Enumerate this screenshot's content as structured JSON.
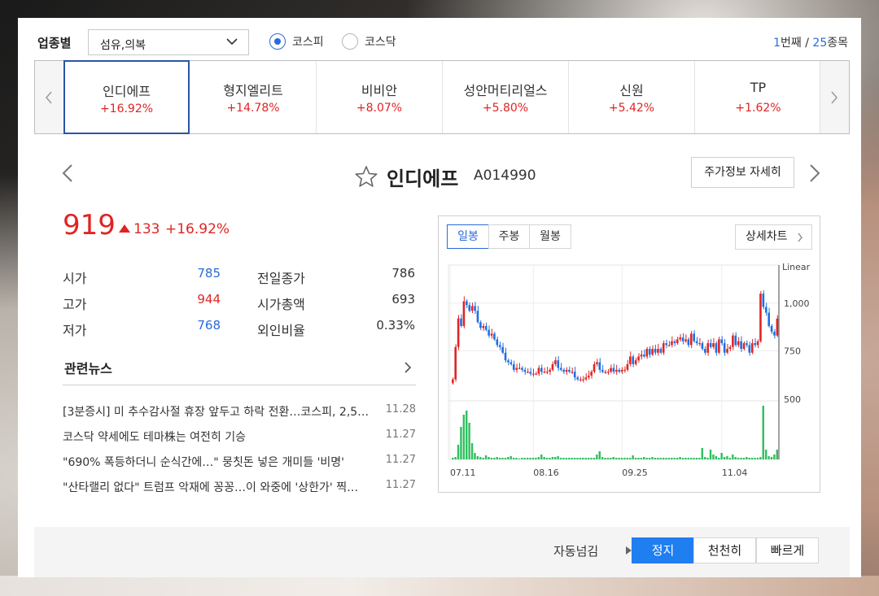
{
  "filter": {
    "sector_label": "업종별",
    "sector_value": "섬유,의복",
    "market_options": [
      {
        "label": "코스피",
        "selected": true
      },
      {
        "label": "코스닥",
        "selected": false
      }
    ],
    "pager": {
      "current": "1",
      "current_suffix": "번째",
      "separator": " / ",
      "total": "25",
      "total_suffix": "종목"
    }
  },
  "tabs": [
    {
      "name": "인디에프",
      "change": "+16.92%",
      "active": true
    },
    {
      "name": "형지엘리트",
      "change": "+14.78%",
      "active": false
    },
    {
      "name": "비비안",
      "change": "+8.07%",
      "active": false
    },
    {
      "name": "성안머티리얼스",
      "change": "+5.80%",
      "active": false
    },
    {
      "name": "신원",
      "change": "+5.42%",
      "active": false
    },
    {
      "name": "TP",
      "change": "+1.62%",
      "active": false
    }
  ],
  "stock": {
    "name": "인디에프",
    "code": "A014990",
    "detail_button": "주가정보 자세히",
    "price": "919",
    "change": "133",
    "change_pct": "+16.92%",
    "stats_left": [
      {
        "label": "시가",
        "value": "785",
        "color": "#2a6ad8"
      },
      {
        "label": "고가",
        "value": "944",
        "color": "#e02424"
      },
      {
        "label": "저가",
        "value": "768",
        "color": "#2a6ad8"
      }
    ],
    "stats_right": [
      {
        "label": "전일종가",
        "value": "786"
      },
      {
        "label": "시가총액",
        "value": "693"
      },
      {
        "label": "외인비율",
        "value": "0.33%"
      }
    ]
  },
  "news": {
    "title": "관련뉴스",
    "items": [
      {
        "title": "[3분증시] 미 추수감사절 휴장 앞두고 하락 전환…코스피, 2,5…",
        "date": "11.28"
      },
      {
        "title": "코스닥 약세에도 테마株는 여전히 기승",
        "date": "11.27"
      },
      {
        "title": "\"690% 폭등하더니 순식간에…\" 뭉칫돈 넣은 개미들 '비명'",
        "date": "11.27"
      },
      {
        "title": "\"산타랠리 없다\" 트럼프 악재에 꽁꽁…이 와중에 '상한가' 찍…",
        "date": "11.27"
      }
    ]
  },
  "chart": {
    "periods": [
      {
        "label": "일봉",
        "active": true
      },
      {
        "label": "주봉",
        "active": false
      },
      {
        "label": "월봉",
        "active": false
      }
    ],
    "detail_label": "상세차트",
    "scale_label": "Linear",
    "colors": {
      "up": "#e02424",
      "down": "#1f6fe0",
      "volume": "#2fbf5e"
    }
  },
  "chart_data": {
    "type": "candlestick",
    "ylim": [
      500,
      1200
    ],
    "yticks": [
      "1,000",
      "750",
      "500"
    ],
    "xticks": [
      "07.11",
      "08.16",
      "09.25",
      "11.04"
    ],
    "closes": [
      600,
      770,
      920,
      880,
      1010,
      990,
      960,
      985,
      960,
      900,
      870,
      880,
      860,
      830,
      840,
      810,
      780,
      770,
      740,
      700,
      690,
      680,
      650,
      660,
      660,
      650,
      640,
      640,
      630,
      630,
      630,
      660,
      640,
      640,
      640,
      650,
      680,
      700,
      660,
      650,
      640,
      650,
      640,
      640,
      610,
      600,
      600,
      600,
      610,
      620,
      640,
      680,
      690,
      650,
      640,
      640,
      640,
      660,
      640,
      650,
      640,
      650,
      650,
      680,
      720,
      680,
      700,
      720,
      730,
      720,
      760,
      730,
      760,
      740,
      760,
      740,
      790,
      780,
      780,
      800,
      790,
      810,
      820,
      800,
      810,
      780,
      840,
      800,
      790,
      790,
      760,
      740,
      790,
      770,
      790,
      740,
      810,
      790,
      740,
      760,
      770,
      830,
      780,
      800,
      760,
      790,
      780,
      740,
      790,
      780,
      800,
      1050,
      980,
      950,
      880,
      850,
      830,
      919
    ],
    "volume_note": "volume bars shown below price pane"
  },
  "autoplay": {
    "label": "자동넘김",
    "buttons": [
      {
        "label": "정지",
        "active": true
      },
      {
        "label": "천천히",
        "active": false
      },
      {
        "label": "빠르게",
        "active": false
      }
    ]
  }
}
